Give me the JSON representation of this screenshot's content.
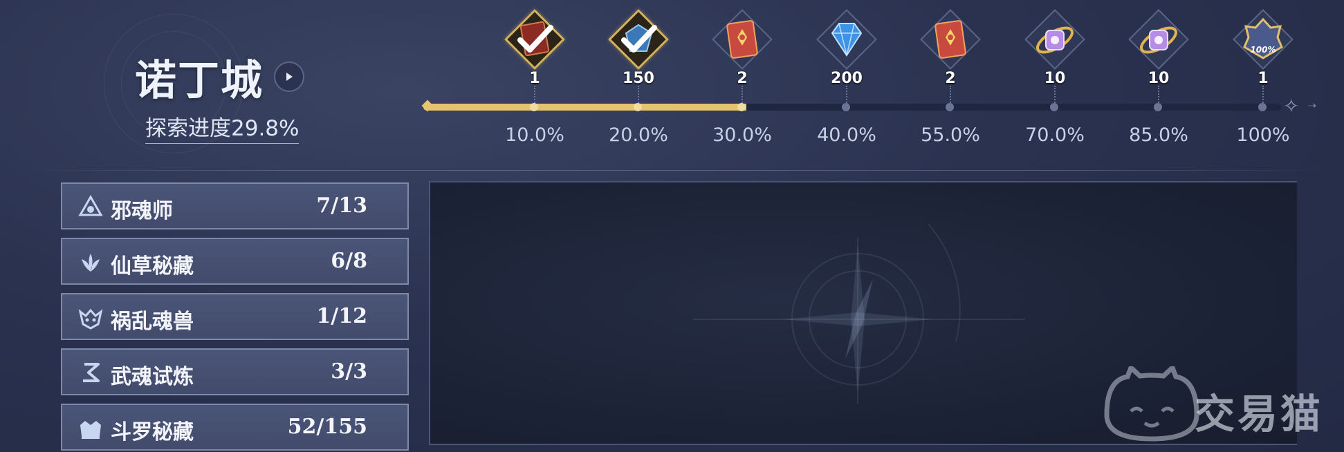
{
  "header": {
    "city_name": "诺丁城",
    "progress_label": "探索进度29.8%",
    "progress_value": 0.298
  },
  "rewards": {
    "track_fill_percent": 30.0,
    "milestones": [
      {
        "icon": "claimed-book-reward-icon",
        "count": "1",
        "percent": "10.0%",
        "state": "claimed"
      },
      {
        "icon": "claimed-crystal-reward-icon",
        "count": "150",
        "percent": "20.0%",
        "state": "claimed"
      },
      {
        "icon": "red-book-icon",
        "count": "2",
        "percent": "30.0%",
        "state": "reached"
      },
      {
        "icon": "blue-diamond-icon",
        "count": "200",
        "percent": "40.0%",
        "state": "locked"
      },
      {
        "icon": "red-book-icon",
        "count": "2",
        "percent": "55.0%",
        "state": "locked"
      },
      {
        "icon": "purple-orb-icon",
        "count": "10",
        "percent": "70.0%",
        "state": "locked"
      },
      {
        "icon": "purple-orb-icon",
        "count": "10",
        "percent": "85.0%",
        "state": "locked"
      },
      {
        "icon": "100-percent-badge-icon",
        "count": "1",
        "percent": "100%",
        "state": "locked",
        "badge_text": "100%"
      }
    ]
  },
  "categories": [
    {
      "icon": "evil-soul-master-icon",
      "name": "邪魂师",
      "count": "7/13"
    },
    {
      "icon": "herb-treasure-icon",
      "name": "仙草秘藏",
      "count": "6/8"
    },
    {
      "icon": "rampaging-beast-icon",
      "name": "祸乱魂兽",
      "count": "1/12"
    },
    {
      "icon": "martial-trial-icon",
      "name": "武魂试炼",
      "count": "3/3"
    },
    {
      "icon": "douluo-treasure-icon",
      "name": "斗罗秘藏",
      "count": "52/155"
    }
  ],
  "watermark": {
    "text": "交易猫",
    "icon": "cat-logo-icon"
  },
  "colors": {
    "gold": "#e5c46e",
    "panel": "#424b6b",
    "background": "#2a3250"
  }
}
